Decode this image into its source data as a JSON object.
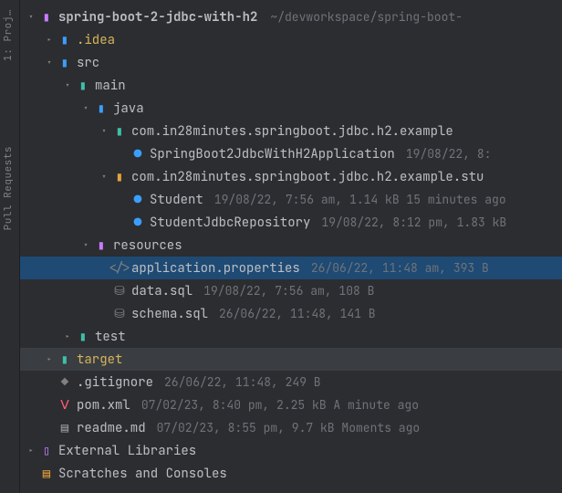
{
  "sidebar": {
    "tab1": "1: Proj…",
    "tab2": "Pull Requests"
  },
  "root": {
    "name": "spring-boot-2-jdbc-with-h2",
    "path": "~/devworkspace/spring-boot-"
  },
  "idea": ".idea",
  "src": "src",
  "main": "main",
  "java": "java",
  "pkg1": "com.in28minutes.springboot.jdbc.h2.example",
  "cls1": {
    "name": "SpringBoot2JdbcWithH2Application",
    "meta": "19/08/22, 8:"
  },
  "pkg2": "com.in28minutes.springboot.jdbc.h2.example.stu",
  "cls2": {
    "name": "Student",
    "meta": "19/08/22, 7:56 am, 1.14 kB 15 minutes ago"
  },
  "cls3": {
    "name": "StudentJdbcRepository",
    "meta": "19/08/22, 8:12 pm, 1.83 kB"
  },
  "resources": "resources",
  "appprops": {
    "name": "application.properties",
    "meta": "26/06/22, 11:48 am, 393 B"
  },
  "datasql": {
    "name": "data.sql",
    "meta": "19/08/22, 7:56 am, 108 B"
  },
  "schemasql": {
    "name": "schema.sql",
    "meta": "26/06/22, 11:48, 141 B"
  },
  "test": "test",
  "target": "target",
  "gitignore": {
    "name": ".gitignore",
    "meta": "26/06/22, 11:48, 249 B"
  },
  "pom": {
    "name": "pom.xml",
    "meta": "07/02/23, 8:40 pm, 2.25 kB A minute ago"
  },
  "readme": {
    "name": "readme.md",
    "meta": "07/02/23, 8:55 pm, 9.7 kB Moments ago"
  },
  "extlib": "External Libraries",
  "scratches": "Scratches and Consoles",
  "arrows": {
    "down": "▾",
    "right": "▸"
  }
}
